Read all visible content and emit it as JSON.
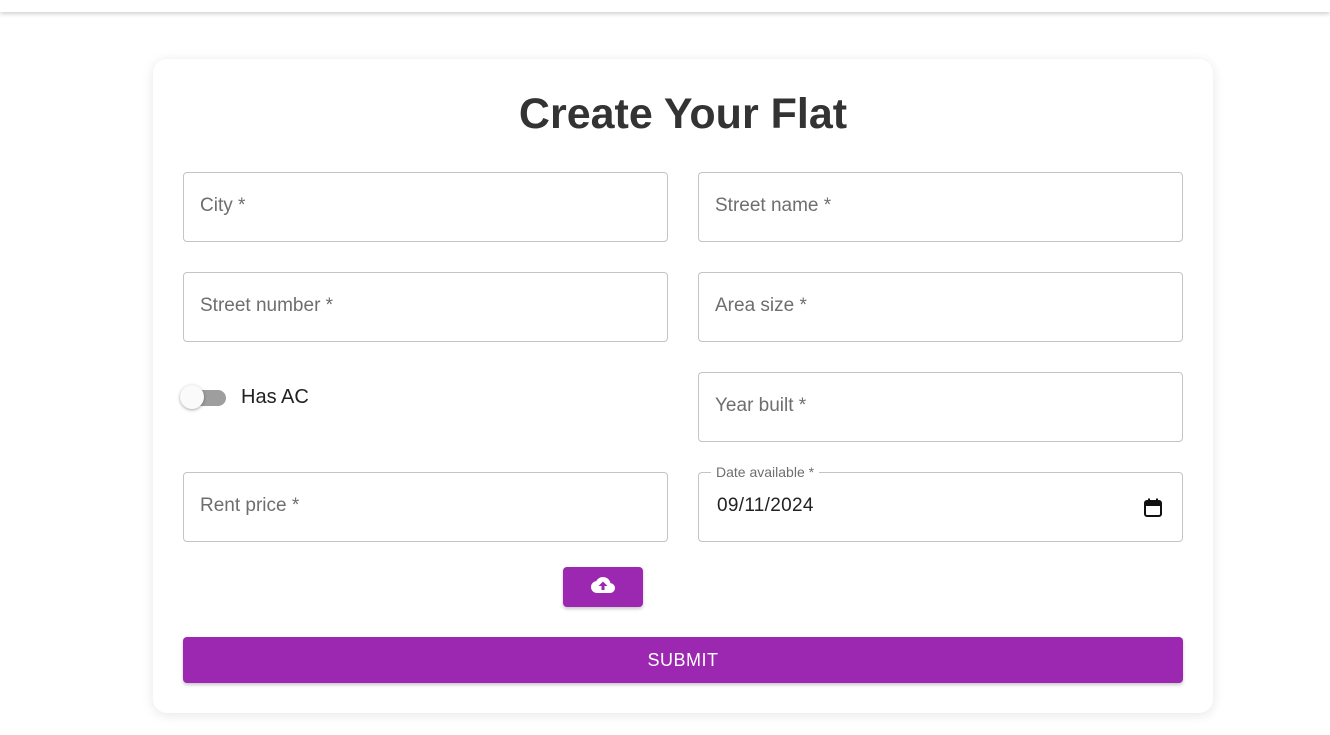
{
  "page": {
    "title": "Create Your Flat"
  },
  "form": {
    "city": {
      "placeholder": "City *"
    },
    "street_name": {
      "placeholder": "Street name *"
    },
    "street_number": {
      "placeholder": "Street number *"
    },
    "area_size": {
      "placeholder": "Area size *"
    },
    "has_ac": {
      "label": "Has AC",
      "checked": false
    },
    "year_built": {
      "placeholder": "Year built *"
    },
    "rent_price": {
      "placeholder": "Rent price *"
    },
    "date_available": {
      "label": "Date available *",
      "value": "09/11/2024"
    },
    "upload_icon": "cloud-upload-icon",
    "submit_label": "SUBMIT"
  },
  "colors": {
    "primary": "#9c27b0",
    "title_text": "#333333",
    "field_border": "#c4c4c4",
    "placeholder_text": "#6e6e6e",
    "switch_track_off": "#9e9e9e"
  }
}
